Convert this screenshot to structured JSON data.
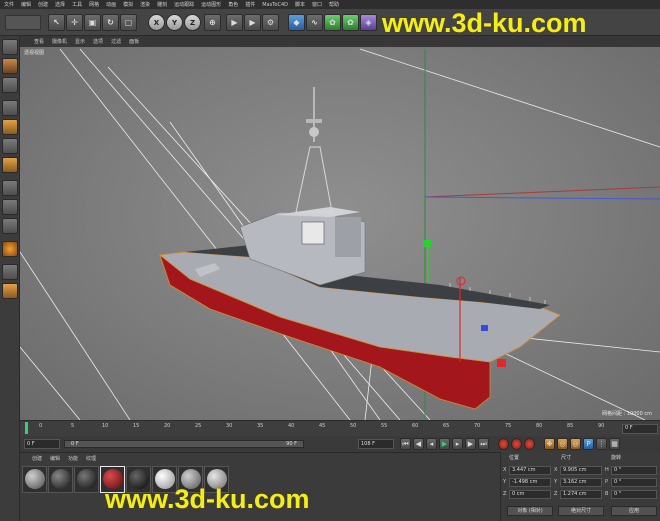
{
  "menubar": {
    "items": [
      "文件",
      "编辑",
      "创建",
      "选择",
      "工具",
      "网格",
      "动画",
      "模拟",
      "渲染",
      "雕刻",
      "运动跟踪",
      "运动图形",
      "角色",
      "插件",
      "MasToC4D",
      "脚本",
      "窗口",
      "帮助"
    ]
  },
  "watermark": "www.3d-ku.com",
  "toolbar": {
    "xyz": [
      "X",
      "Y",
      "Z"
    ]
  },
  "viewport": {
    "menu": [
      "查看",
      "摄像机",
      "显示",
      "选项",
      "过滤",
      "面板"
    ],
    "name": "透视视图",
    "grid_label": "网格间距 : 10000 cm"
  },
  "timeline": {
    "ticks": [
      "0",
      "5",
      "10",
      "15",
      "20",
      "25",
      "30",
      "35",
      "40",
      "45",
      "50",
      "55",
      "60",
      "65",
      "70",
      "75",
      "80",
      "85",
      "90"
    ],
    "right_field": "0 F"
  },
  "playbar": {
    "start": "0 F",
    "slider_left": "0 F",
    "slider_right": "90 F",
    "end": "108 F"
  },
  "materials": {
    "menu": [
      "创建",
      "编辑",
      "功能",
      "纹理"
    ]
  },
  "attributes": {
    "headers": [
      "位置",
      "尺寸",
      "旋转"
    ],
    "axes": [
      "X",
      "Y",
      "Z"
    ],
    "position": [
      "3.447 cm",
      "-1.498 cm",
      "0 cm"
    ],
    "size": [
      "9.905 cm",
      "3.162 cm",
      "1.274 cm"
    ],
    "rotation_axes": [
      "H",
      "P",
      "B"
    ],
    "rotation": [
      "0 °",
      "0 °",
      "0 °"
    ],
    "buttons": [
      "对象 (相对)",
      "绝对尺寸",
      "应用"
    ]
  },
  "colors": {
    "timeline_cursor": "#37d07a",
    "hull_red": "#a3161b",
    "hull_grey": "#a8acb2",
    "watermark": "#f2ee1e",
    "axis_green": "#2bd12e",
    "axis_red": "#e0282c",
    "axis_blue": "#3548e4"
  }
}
